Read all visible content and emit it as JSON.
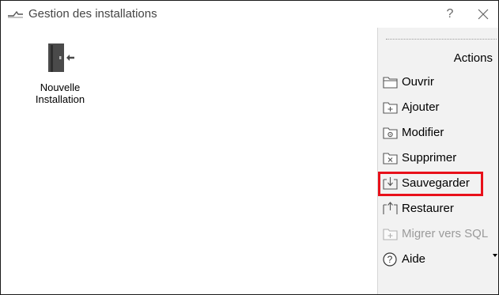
{
  "window": {
    "title": "Gestion des installations",
    "help_label": "?"
  },
  "main": {
    "items": [
      {
        "label_line1": "Nouvelle",
        "label_line2": "Installation",
        "icon": "door-enter-icon"
      }
    ]
  },
  "actions": {
    "heading": "Actions",
    "items": [
      {
        "label": "Ouvrir",
        "icon": "folder-open-icon",
        "enabled": true
      },
      {
        "label": "Ajouter",
        "icon": "folder-add-icon",
        "enabled": true
      },
      {
        "label": "Modifier",
        "icon": "folder-edit-icon",
        "enabled": true
      },
      {
        "label": "Supprimer",
        "icon": "folder-delete-icon",
        "enabled": true
      },
      {
        "label": "Sauvegarder",
        "icon": "save-download-icon",
        "enabled": true,
        "highlighted": true
      },
      {
        "label": "Restaurer",
        "icon": "restore-upload-icon",
        "enabled": true
      },
      {
        "label": "Migrer vers SQL",
        "icon": "migrate-sql-icon",
        "enabled": false
      },
      {
        "label": "Aide",
        "icon": "help-circle-icon",
        "enabled": true,
        "has_dropdown": true
      }
    ]
  },
  "colors": {
    "highlight": "#e8101a",
    "actions_background": "#f2f2f2",
    "disabled_text": "#9a9a9a"
  }
}
